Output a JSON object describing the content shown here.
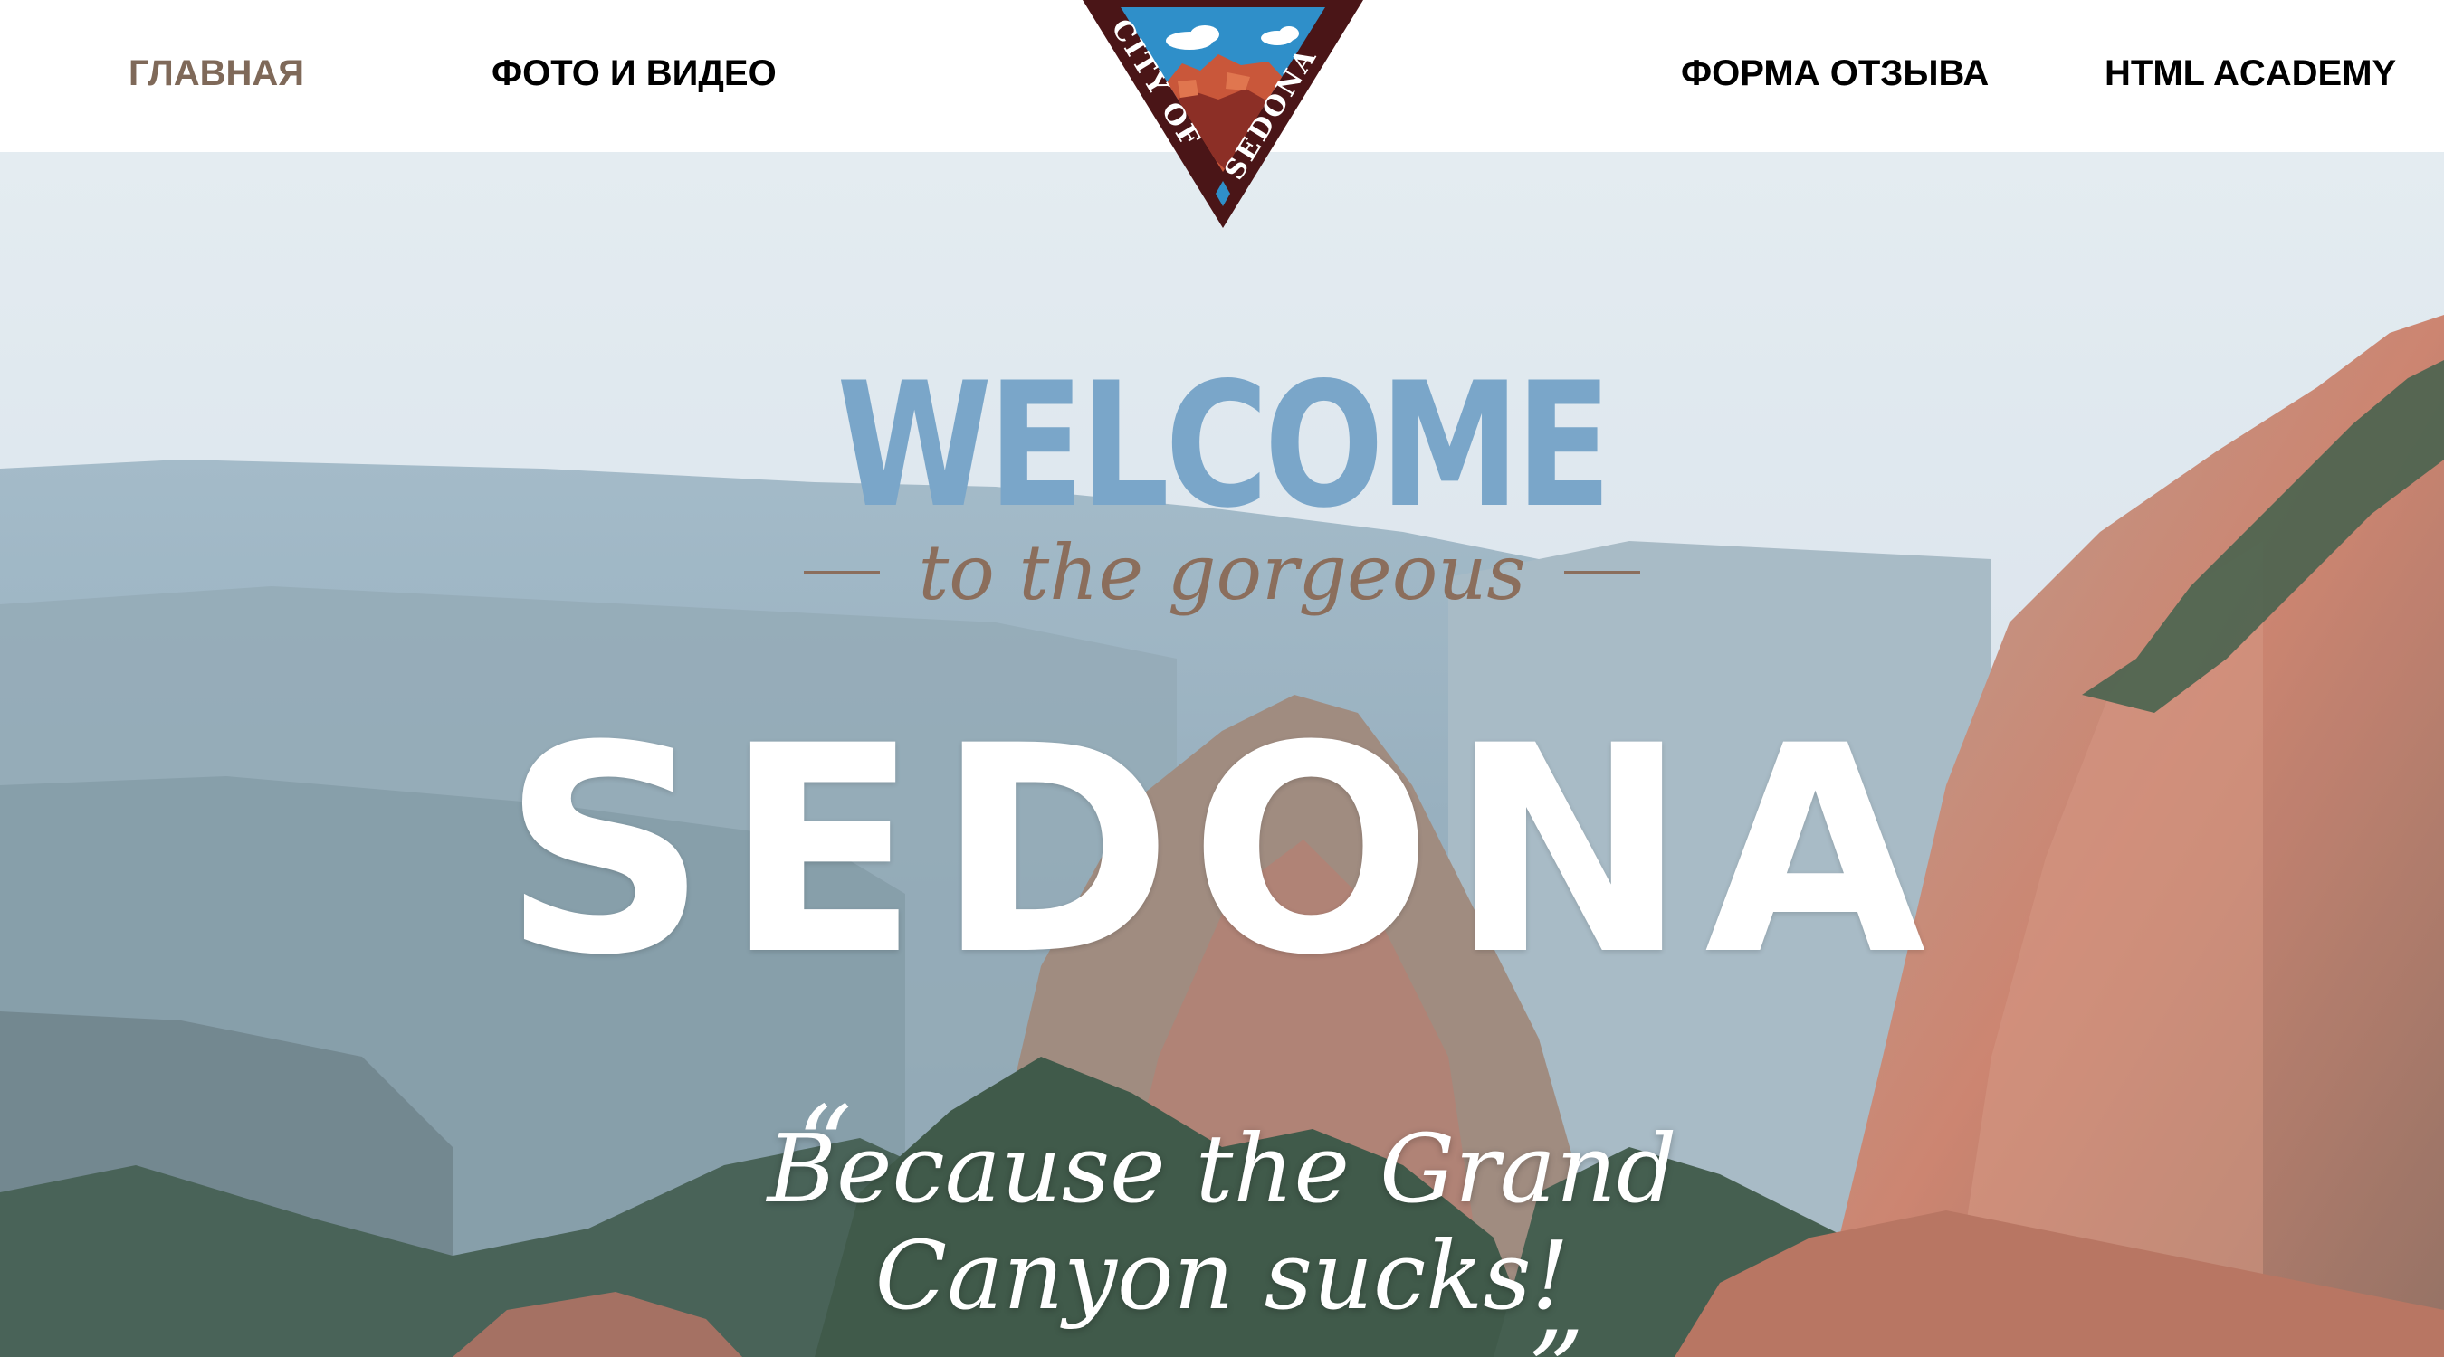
{
  "nav": {
    "home": "ГЛАВНАЯ",
    "photo_video": "ФОТО И ВИДЕО",
    "feedback_form": "ФОРМА ОТЗЫВА",
    "html_academy": "HTML ACADEMY"
  },
  "logo": {
    "text": "CITY OF SEDONA",
    "icon": "city-of-sedona-emblem"
  },
  "hero": {
    "welcome": "WELCOME",
    "tagline": "to the gorgeous",
    "city": "SEDONA",
    "quote_open": "“",
    "quote_line1": "Because the Grand",
    "quote_line2": "Canyon sucks!",
    "quote_close": "„"
  },
  "colors": {
    "nav_active": "#7f6959",
    "welcome": "#7aa6c9",
    "tagline": "#8b6e5c",
    "logo_dark": "#4a1517",
    "logo_sky": "#2f8fc9",
    "logo_rock": "#c9573a"
  }
}
